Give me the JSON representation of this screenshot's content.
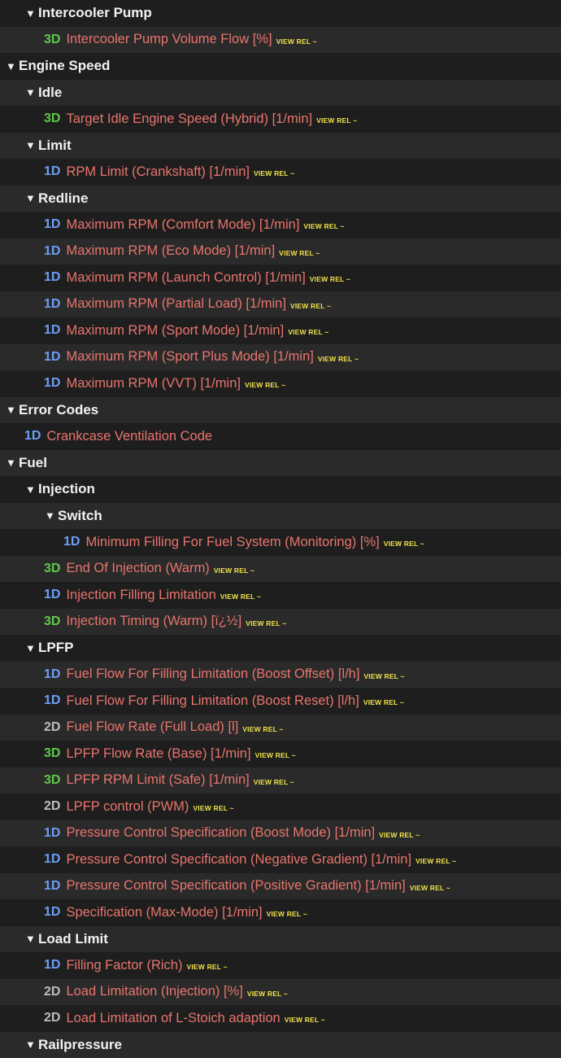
{
  "rows": [
    {
      "type": "header",
      "level": 1,
      "label": "Intercooler Pump"
    },
    {
      "type": "item",
      "level": 2,
      "dim": "3D",
      "label": "Intercooler Pump Volume Flow [%]",
      "rel": "VIEW REL ~"
    },
    {
      "type": "header",
      "level": 0,
      "label": "Engine Speed"
    },
    {
      "type": "header",
      "level": 1,
      "label": "Idle"
    },
    {
      "type": "item",
      "level": 2,
      "dim": "3D",
      "label": "Target Idle Engine Speed (Hybrid) [1/min]",
      "rel": "VIEW REL ~"
    },
    {
      "type": "header",
      "level": 1,
      "label": "Limit"
    },
    {
      "type": "item",
      "level": 2,
      "dim": "1D",
      "label": "RPM Limit (Crankshaft) [1/min]",
      "rel": "VIEW REL ~"
    },
    {
      "type": "header",
      "level": 1,
      "label": "Redline"
    },
    {
      "type": "item",
      "level": 2,
      "dim": "1D",
      "label": "Maximum RPM (Comfort Mode) [1/min]",
      "rel": "VIEW REL ~"
    },
    {
      "type": "item",
      "level": 2,
      "dim": "1D",
      "label": "Maximum RPM (Eco Mode) [1/min]",
      "rel": "VIEW REL ~"
    },
    {
      "type": "item",
      "level": 2,
      "dim": "1D",
      "label": "Maximum RPM (Launch Control) [1/min]",
      "rel": "VIEW REL ~"
    },
    {
      "type": "item",
      "level": 2,
      "dim": "1D",
      "label": "Maximum RPM (Partial Load) [1/min]",
      "rel": "VIEW REL ~"
    },
    {
      "type": "item",
      "level": 2,
      "dim": "1D",
      "label": "Maximum RPM (Sport Mode) [1/min]",
      "rel": "VIEW REL ~"
    },
    {
      "type": "item",
      "level": 2,
      "dim": "1D",
      "label": "Maximum RPM (Sport Plus Mode) [1/min]",
      "rel": "VIEW REL ~"
    },
    {
      "type": "item",
      "level": 2,
      "dim": "1D",
      "label": "Maximum RPM (VVT) [1/min]",
      "rel": "VIEW REL ~"
    },
    {
      "type": "header",
      "level": 0,
      "label": "Error Codes"
    },
    {
      "type": "item",
      "level": 1,
      "dim": "1D",
      "label": "Crankcase Ventilation Code",
      "rel": ""
    },
    {
      "type": "header",
      "level": 0,
      "label": "Fuel"
    },
    {
      "type": "header",
      "level": 1,
      "label": "Injection"
    },
    {
      "type": "header",
      "level": 2,
      "label": "Switch"
    },
    {
      "type": "item",
      "level": 3,
      "dim": "1D",
      "label": "Minimum Filling For Fuel System (Monitoring) [%]",
      "rel": "VIEW REL ~"
    },
    {
      "type": "item",
      "level": 2,
      "dim": "3D",
      "label": "End Of Injection (Warm)",
      "rel": "VIEW REL ~"
    },
    {
      "type": "item",
      "level": 2,
      "dim": "1D",
      "label": "Injection Filling Limitation",
      "rel": "VIEW REL ~"
    },
    {
      "type": "item",
      "level": 2,
      "dim": "3D",
      "label": "Injection Timing (Warm) [ï¿½]",
      "rel": "VIEW REL ~"
    },
    {
      "type": "header",
      "level": 1,
      "label": "LPFP"
    },
    {
      "type": "item",
      "level": 2,
      "dim": "1D",
      "label": "Fuel Flow For Filling Limitation (Boost Offset) [l/h]",
      "rel": "VIEW REL ~"
    },
    {
      "type": "item",
      "level": 2,
      "dim": "1D",
      "label": "Fuel Flow For Filling Limitation (Boost Reset) [l/h]",
      "rel": "VIEW REL ~"
    },
    {
      "type": "item",
      "level": 2,
      "dim": "2D",
      "label": "Fuel Flow Rate (Full Load) [l]",
      "rel": "VIEW REL ~"
    },
    {
      "type": "item",
      "level": 2,
      "dim": "3D",
      "label": "LPFP Flow Rate (Base) [1/min]",
      "rel": "VIEW REL ~"
    },
    {
      "type": "item",
      "level": 2,
      "dim": "3D",
      "label": "LPFP RPM Limit (Safe) [1/min]",
      "rel": "VIEW REL ~"
    },
    {
      "type": "item",
      "level": 2,
      "dim": "2D",
      "label": "LPFP control (PWM)",
      "rel": "VIEW REL ~"
    },
    {
      "type": "item",
      "level": 2,
      "dim": "1D",
      "label": "Pressure Control Specification (Boost Mode) [1/min]",
      "rel": "VIEW REL ~"
    },
    {
      "type": "item",
      "level": 2,
      "dim": "1D",
      "label": "Pressure Control Specification (Negative Gradient) [1/min]",
      "rel": "VIEW REL ~"
    },
    {
      "type": "item",
      "level": 2,
      "dim": "1D",
      "label": "Pressure Control Specification (Positive Gradient) [1/min]",
      "rel": "VIEW REL ~"
    },
    {
      "type": "item",
      "level": 2,
      "dim": "1D",
      "label": "Specification (Max-Mode) [1/min]",
      "rel": "VIEW REL ~"
    },
    {
      "type": "header",
      "level": 1,
      "label": "Load Limit"
    },
    {
      "type": "item",
      "level": 2,
      "dim": "1D",
      "label": "Filling Factor (Rich)",
      "rel": "VIEW REL ~"
    },
    {
      "type": "item",
      "level": 2,
      "dim": "2D",
      "label": "Load Limitation (Injection) [%]",
      "rel": "VIEW REL ~"
    },
    {
      "type": "item",
      "level": 2,
      "dim": "2D",
      "label": "Load Limitation of L-Stoich adaption",
      "rel": "VIEW REL ~"
    },
    {
      "type": "header",
      "level": 1,
      "label": "Railpressure"
    }
  ],
  "icons": {
    "expanded": "caret-down-icon"
  },
  "colors": {
    "background": "#1e1e1e",
    "row_alt": "#2a2a2a",
    "label": "#e8756d",
    "dim_1d": "#6e9ef5",
    "dim_2d": "#bdbdbd",
    "dim_3d": "#5fc94a",
    "rel": "#f0e24a"
  }
}
